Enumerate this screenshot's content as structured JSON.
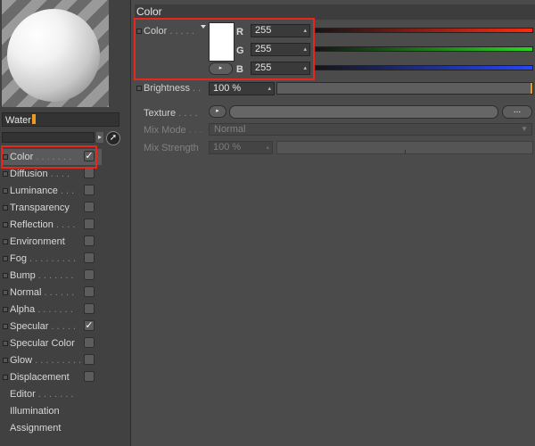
{
  "material": {
    "name": "Water"
  },
  "channels": [
    {
      "label": "Color",
      "dots": " . . . . . . .",
      "checked": true,
      "has_checkbox": true,
      "selected": true
    },
    {
      "label": "Diffusion",
      "dots": " . . . .",
      "checked": false,
      "has_checkbox": true
    },
    {
      "label": "Luminance",
      "dots": " . . .",
      "checked": false,
      "has_checkbox": true
    },
    {
      "label": "Transparency",
      "dots": "",
      "checked": false,
      "has_checkbox": true
    },
    {
      "label": "Reflection",
      "dots": " . . . .",
      "checked": false,
      "has_checkbox": true
    },
    {
      "label": "Environment",
      "dots": "",
      "checked": false,
      "has_checkbox": true
    },
    {
      "label": "Fog",
      "dots": " . . . . . . . . .",
      "checked": false,
      "has_checkbox": true
    },
    {
      "label": "Bump",
      "dots": " . . . . . . .",
      "checked": false,
      "has_checkbox": true
    },
    {
      "label": "Normal",
      "dots": " . . . . . .",
      "checked": false,
      "has_checkbox": true
    },
    {
      "label": "Alpha",
      "dots": " . . . . . . .",
      "checked": false,
      "has_checkbox": true
    },
    {
      "label": "Specular",
      "dots": " . . . . .",
      "checked": true,
      "has_checkbox": true
    },
    {
      "label": "Specular Color",
      "dots": "",
      "checked": false,
      "has_checkbox": true
    },
    {
      "label": "Glow",
      "dots": " . . . . . . . . .",
      "checked": false,
      "has_checkbox": true
    },
    {
      "label": "Displacement",
      "dots": "",
      "checked": false,
      "has_checkbox": true
    },
    {
      "label": "Editor",
      "dots": " . . . . . . .",
      "checked": false,
      "has_checkbox": false
    },
    {
      "label": "Illumination",
      "dots": "",
      "checked": false,
      "has_checkbox": false
    },
    {
      "label": "Assignment",
      "dots": "",
      "checked": false,
      "has_checkbox": false
    }
  ],
  "panel": {
    "title": "Color",
    "color_label": "Color",
    "color_dots": " . . . . .",
    "r_label": "R",
    "g_label": "G",
    "b_label": "B",
    "r": "255",
    "g": "255",
    "b": "255",
    "brightness_label": "Brightness",
    "brightness_dots": " . .",
    "brightness": "100 %",
    "texture_label": "Texture",
    "texture_dots": " . . . .",
    "texture_more": "...",
    "mix_mode_label": "Mix Mode",
    "mix_mode_dots": " . . .",
    "mix_mode": "Normal",
    "mix_strength_label": "Mix Strength",
    "mix_strength": "100 %"
  },
  "colors": {
    "highlight": "#e8261b",
    "swatch": "#ffffff"
  }
}
